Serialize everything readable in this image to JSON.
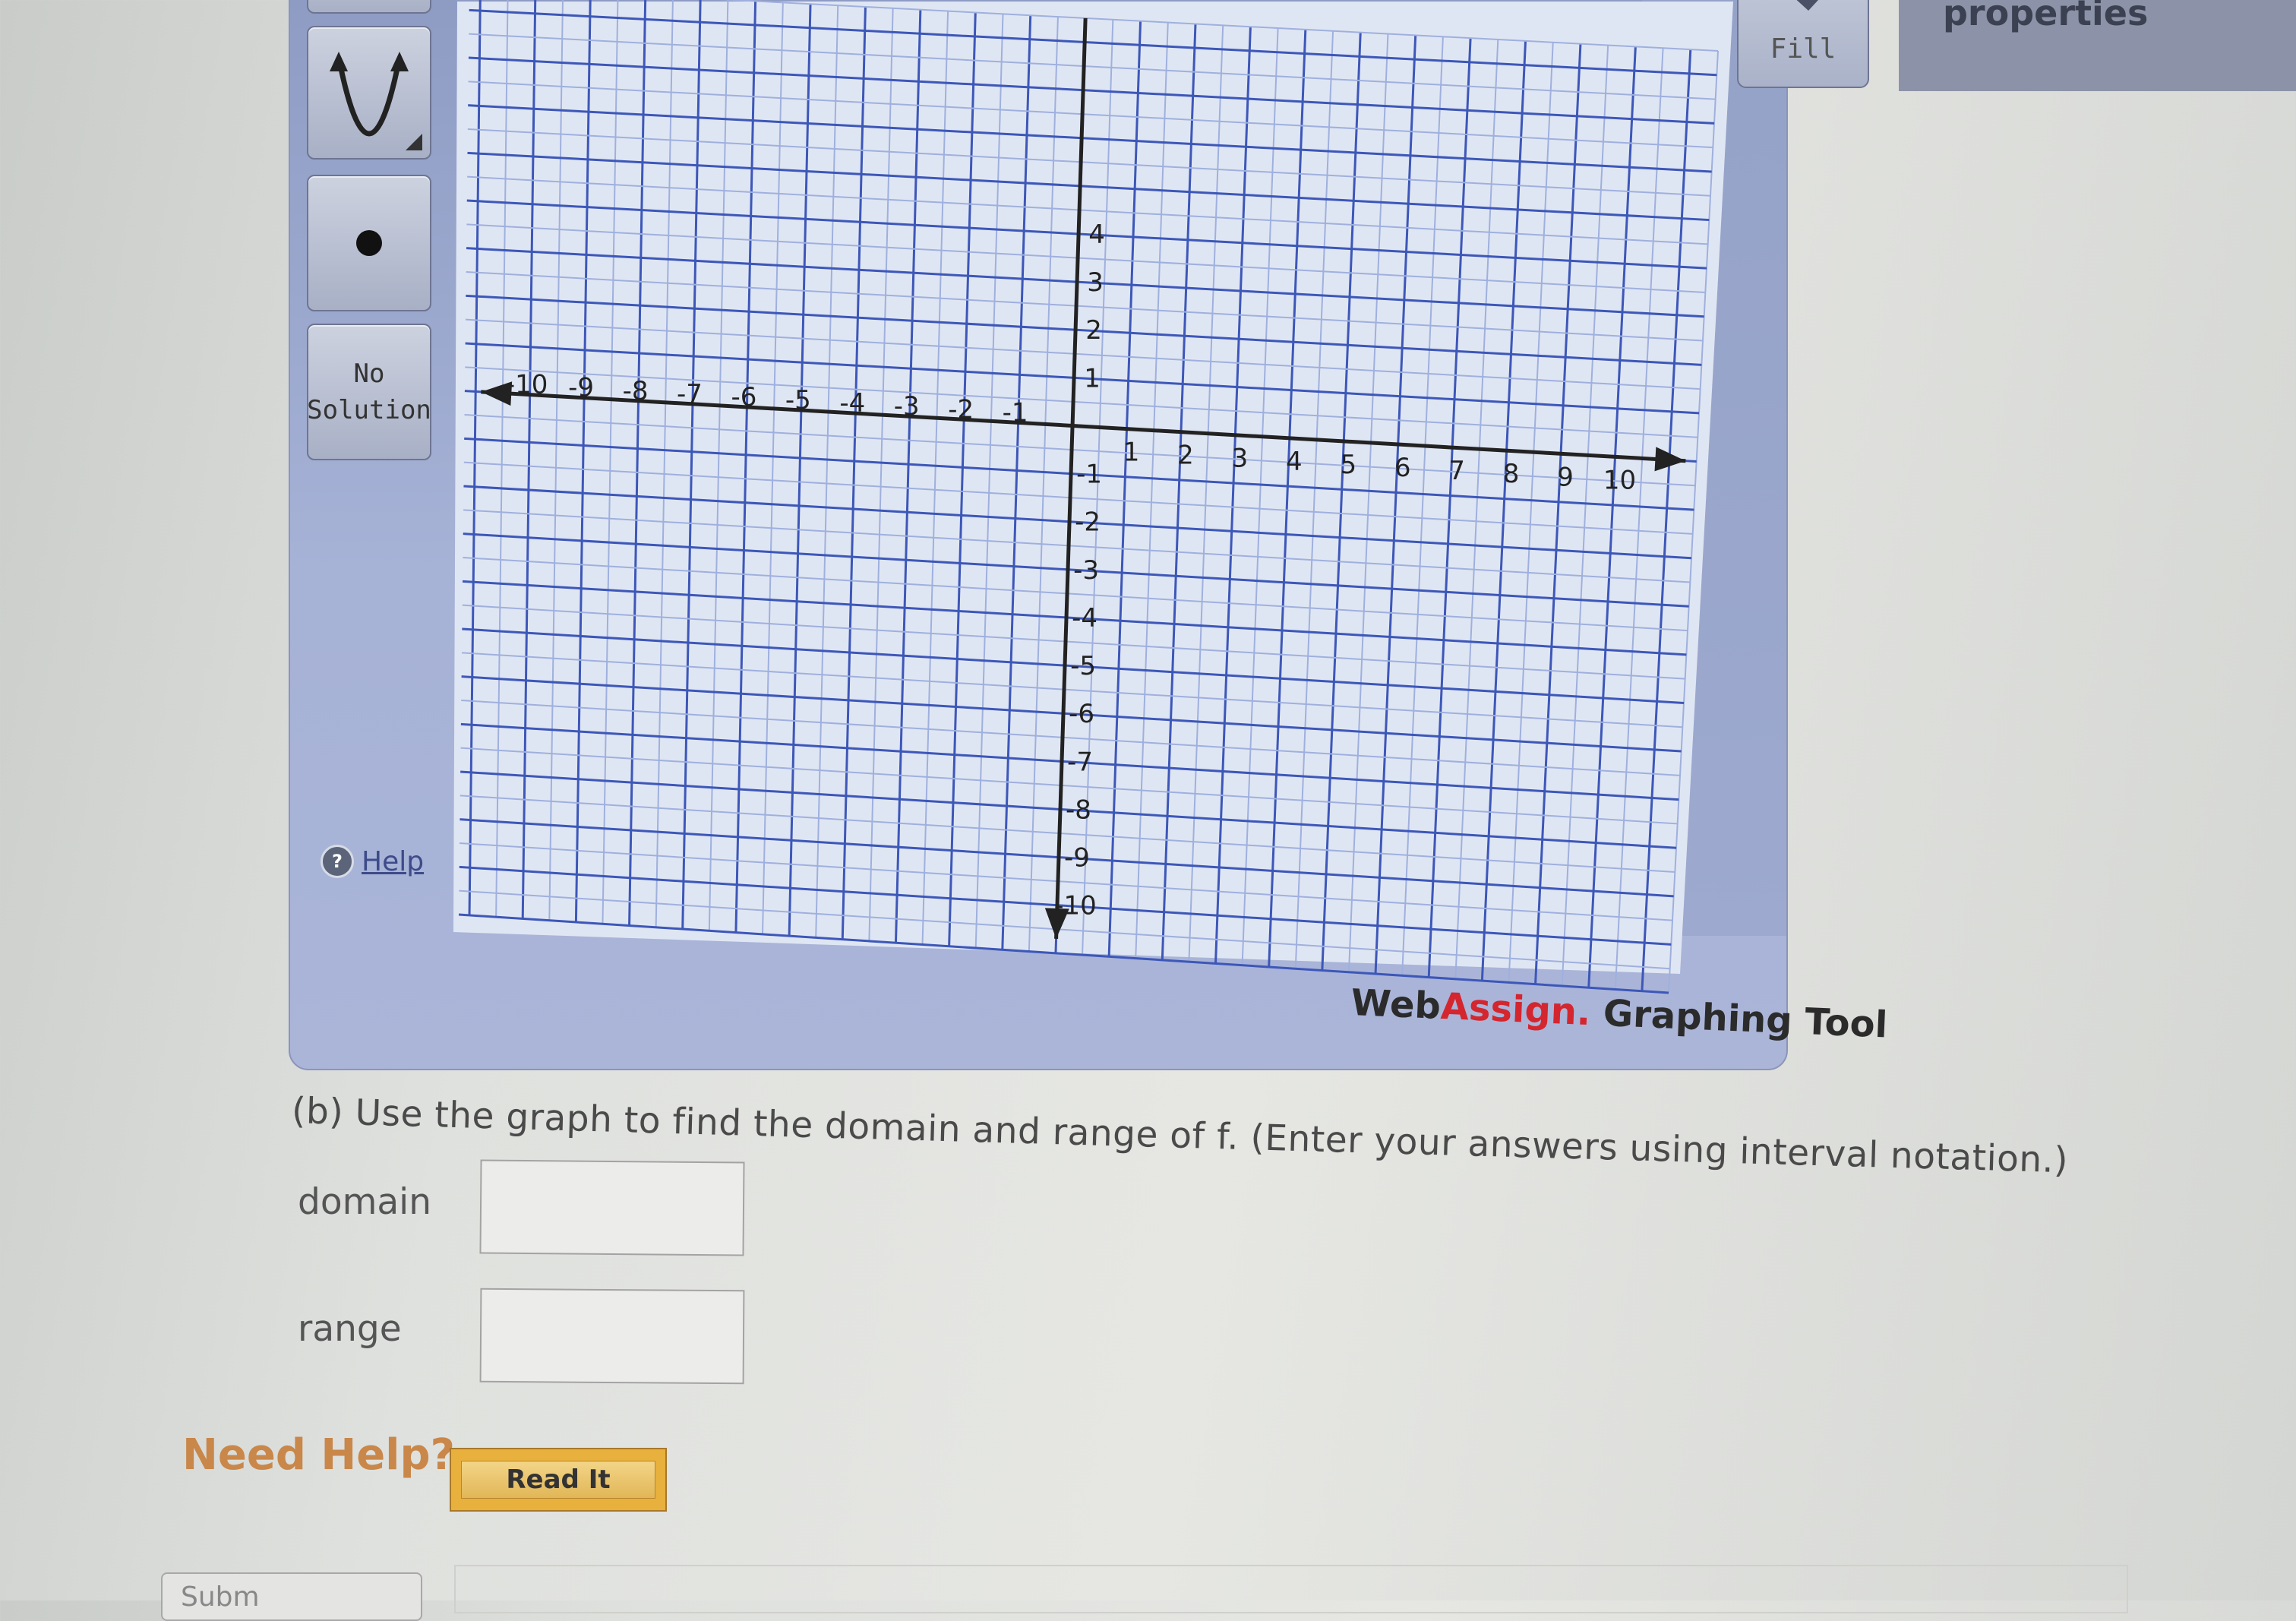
{
  "toolbar": {
    "no_solution_label_1": "No",
    "no_solution_label_2": "Solution",
    "help_label": "Help",
    "fill_label": "Fill"
  },
  "properties_label": "properties",
  "graph": {
    "x_ticks": [
      "-10",
      "-9",
      "-8",
      "-7",
      "-6",
      "-5",
      "-4",
      "-3",
      "-2",
      "-1",
      "1",
      "2",
      "3",
      "4",
      "5",
      "6",
      "7",
      "8",
      "9",
      "10"
    ],
    "y_ticks": [
      "4",
      "3",
      "2",
      "1",
      "-1",
      "-2",
      "-3",
      "-4",
      "-5",
      "-6",
      "-7",
      "-8",
      "-9",
      "-10"
    ],
    "xlim": [
      -10,
      10
    ],
    "ylim": [
      -10,
      4
    ],
    "grid": true
  },
  "brand": {
    "web": "Web",
    "assign": "Assign.",
    "tool": " Graphing Tool"
  },
  "question": {
    "text": "(b) Use the graph to find the domain and range of f. (Enter your answers using interval notation.)",
    "domain_label": "domain",
    "range_label": "range",
    "domain_value": "",
    "range_value": ""
  },
  "help": {
    "need_help": "Need Help?",
    "read_it": "Read It"
  },
  "submit_label": "Subm"
}
